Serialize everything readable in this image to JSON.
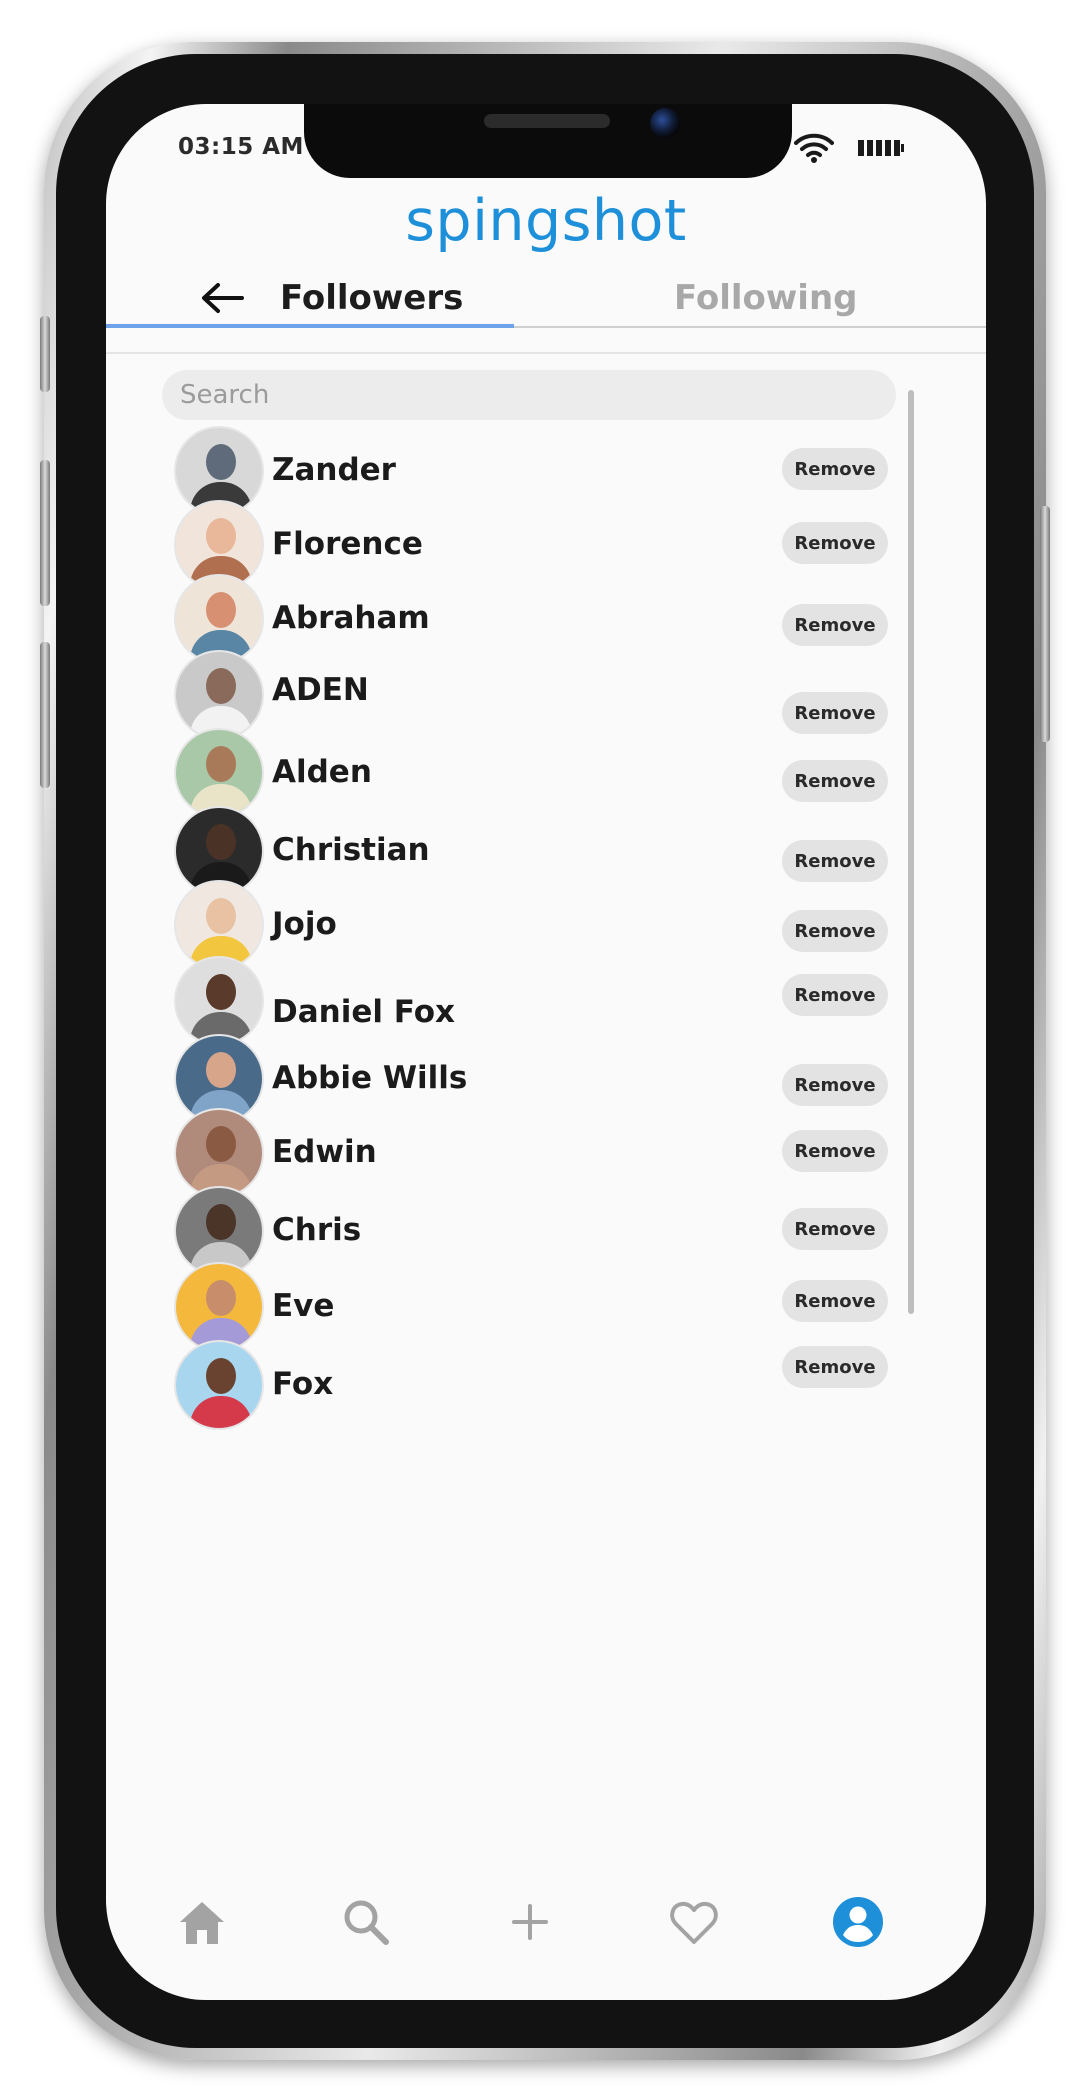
{
  "status_bar": {
    "time": "03:15 AM"
  },
  "brand": {
    "name": "spingshot"
  },
  "tabs": {
    "followers": "Followers",
    "following": "Following"
  },
  "search": {
    "placeholder": "Search"
  },
  "followers": [
    {
      "name": "Zander",
      "action": "Remove"
    },
    {
      "name": "Florence",
      "action": "Remove"
    },
    {
      "name": "Abraham",
      "action": "Remove"
    },
    {
      "name": "ADEN",
      "action": "Remove"
    },
    {
      "name": "Alden",
      "action": "Remove"
    },
    {
      "name": "Christian",
      "action": "Remove"
    },
    {
      "name": "Jojo",
      "action": "Remove"
    },
    {
      "name": "Daniel Fox",
      "action": "Remove"
    },
    {
      "name": "Abbie Wills",
      "action": "Remove"
    },
    {
      "name": "Edwin",
      "action": "Remove"
    },
    {
      "name": "Chris",
      "action": "Remove"
    },
    {
      "name": "Eve",
      "action": "Remove"
    },
    {
      "name": "Fox",
      "action": "Remove"
    }
  ],
  "bottom_nav": [
    "home-icon",
    "search-icon",
    "plus-icon",
    "heart-icon",
    "profile-icon"
  ],
  "colors": {
    "accent": "#1e8fd9",
    "tab_underline": "#6ea2ea",
    "nav_inactive": "#a3a3a3",
    "nav_active": "#1e8fd9"
  }
}
